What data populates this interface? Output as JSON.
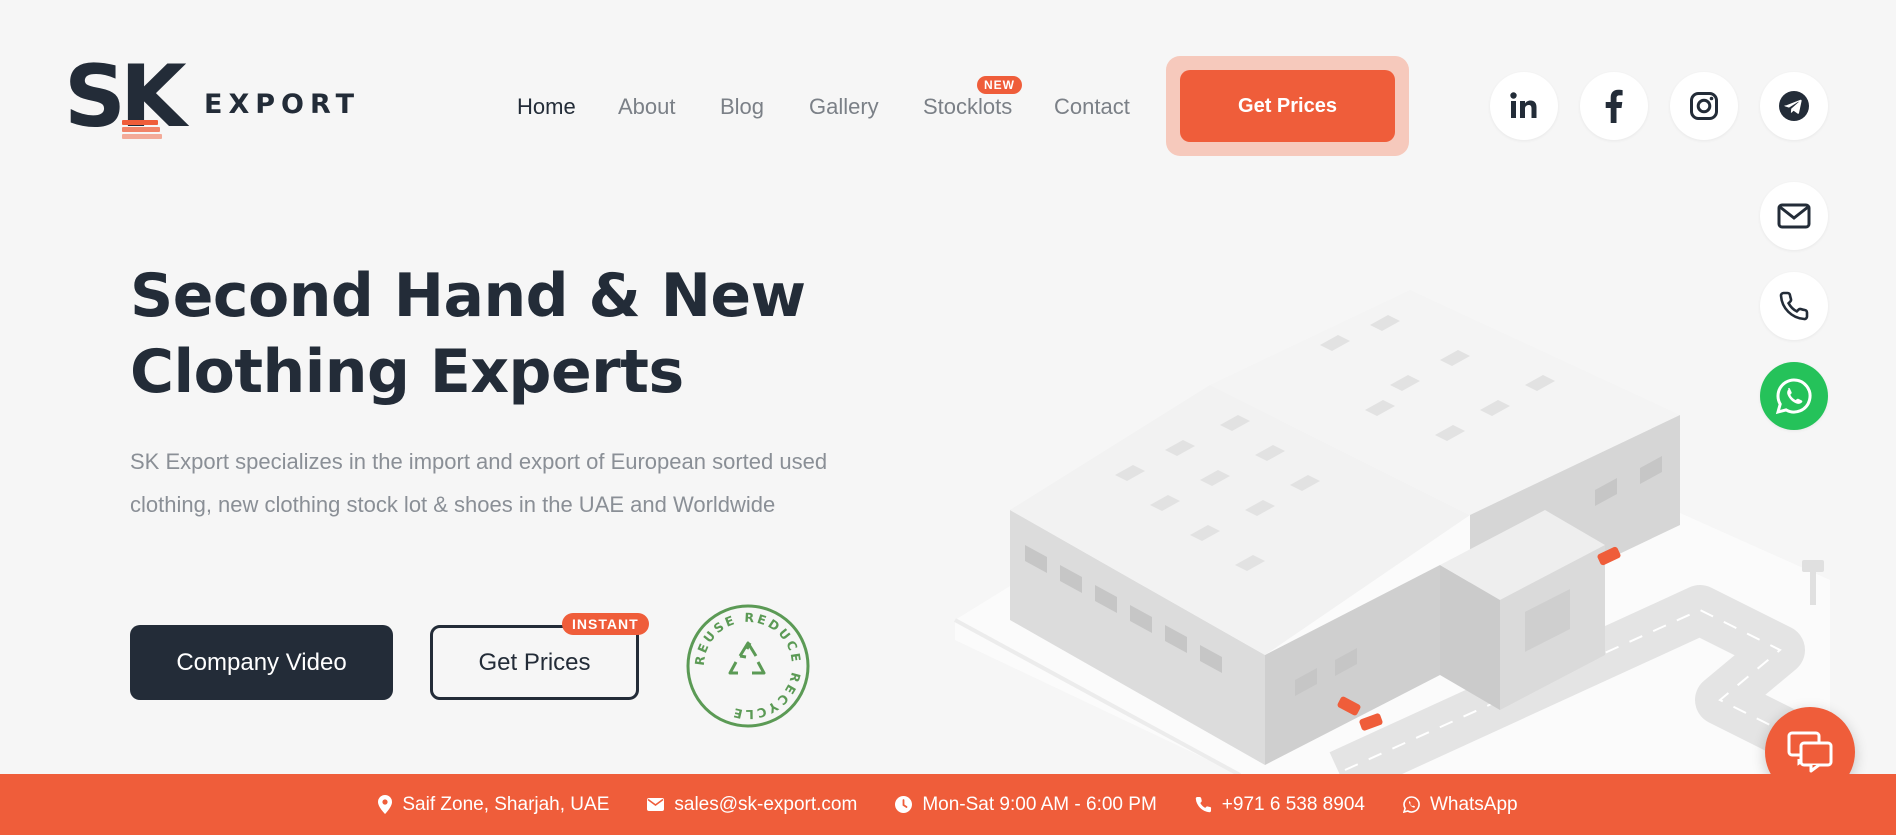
{
  "brand": {
    "mark": "SK",
    "wordmark": "EXPORT",
    "accent_color": "#ef5d3a",
    "dark_color": "#232c38"
  },
  "nav": {
    "items": [
      {
        "label": "Home",
        "active": true
      },
      {
        "label": "About"
      },
      {
        "label": "Blog"
      },
      {
        "label": "Gallery"
      },
      {
        "label": "Stocklots",
        "badge": "NEW"
      },
      {
        "label": "Contact"
      }
    ],
    "cta_label": "Get Prices"
  },
  "social": {
    "icons": [
      "linkedin-icon",
      "facebook-icon",
      "instagram-icon",
      "telegram-icon",
      "email-icon",
      "phone-icon",
      "whatsapp-icon"
    ],
    "whatsapp_color": "#25c25a"
  },
  "hero": {
    "title_line1": "Second Hand & New",
    "title_line2": "Clothing Experts",
    "description": "SK Export specializes in the import and export of European sorted used clothing, new clothing stock lot & shoes in the UAE and Worldwide",
    "primary_button": "Company Video",
    "secondary_button": "Get Prices",
    "secondary_badge": "INSTANT",
    "seal_text": "REUSE REDUCE RECYCLE"
  },
  "bottom_bar": {
    "address": "Saif Zone, Sharjah, UAE",
    "email": "sales@sk-export.com",
    "hours": "Mon-Sat 9:00 AM - 6:00 PM",
    "phone": "+971 6 538 8904",
    "whatsapp": "WhatsApp"
  }
}
